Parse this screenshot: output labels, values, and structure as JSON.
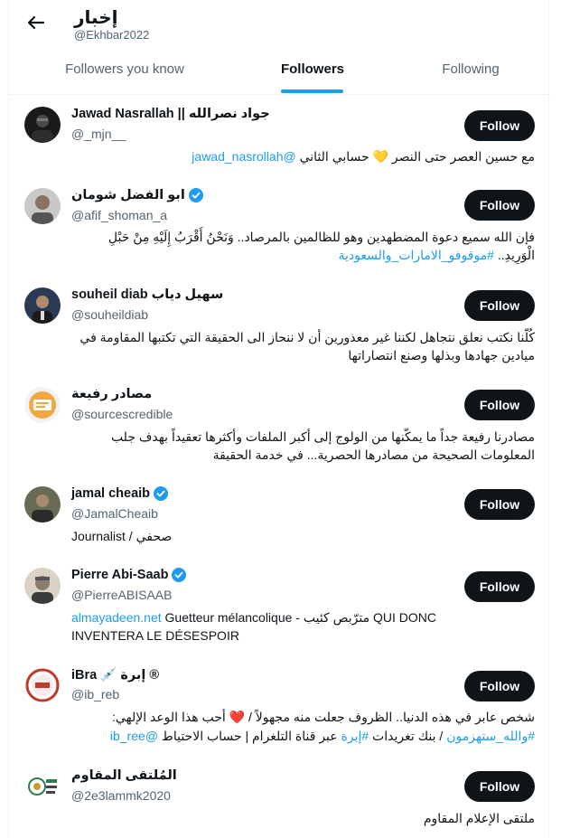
{
  "header": {
    "title": "إخبار",
    "handle": "@Ekhbar2022"
  },
  "tabs": [
    {
      "label": "Followers you know"
    },
    {
      "label": "Followers"
    },
    {
      "label": "Following"
    }
  ],
  "colors": {
    "accent": "#1d9bf0",
    "button_bg": "#0f1419",
    "secondary_text": "#536471",
    "heart": "#e0245e",
    "yellow_heart": "#f5c842"
  },
  "follow_label": "Follow",
  "followers": [
    {
      "name": "Jawad Nasrallah || جواد نصرالله",
      "handle": "@_mjn__",
      "verified": false,
      "bio": {
        "text1": "مع حسين العصر حتى النصر ",
        "emoji": "💛",
        "text2": " حسابي الثاني ",
        "link": "@jawad_nasrollah"
      }
    },
    {
      "name": "ابو الفضل شومان",
      "handle": "@afif_shoman_a",
      "verified": true,
      "bio": {
        "line1": "فإن الله سميع دعوة المضطهدين وهو للظالمين بالمرصاد.. وَنَحْنُ أَقْرَبُ إِلَيْهِ مِنْ حَبْلِ",
        "line2": "الْوَرِيدِ.. ",
        "hashtag": "#موقوفو_الامارات_والسعودية"
      }
    },
    {
      "name": "souheil diab سهيل دياب",
      "handle": "@souheildiab",
      "verified": false,
      "bio": {
        "text": "كُلّنا نكتب نعلق نتجاهل لكننا غير معذورين أن لا ننحاز الى الحقيقة التي تكتبها المقاومة في ميادين جهادها وبذلها وصنع انتصاراتها"
      }
    },
    {
      "name": "مصادر رفيعة",
      "handle": "@sourcescredible",
      "verified": false,
      "bio": {
        "text": "مصادرنا رفيعة جداً ما يمكّنها من الولوج إلى أكبر الملفات وأكثرها تعقيداً بهدف جلب المعلومات الصحيحة من مصادرها الحصرية... في خدمة الحقيقة"
      }
    },
    {
      "name": "jamal cheaib",
      "handle": "@JamalCheaib",
      "verified": true,
      "bio": {
        "text": "Journalist / صحفي"
      }
    },
    {
      "name": "Pierre Abi-Saab",
      "handle": "@PierreABISAAB",
      "verified": true,
      "bio": {
        "link": "almayadeen.net",
        "line1": " Guetteur mélancolique - مترّبص كئيب QUI DONC",
        "line2": "INVENTERA LE DÉSESPOIR"
      }
    },
    {
      "name": "iBra 💉 إبرة ®",
      "handle": "@ib_reb",
      "verified": false,
      "bio": {
        "line1a": "شخص عابر في هذه الدنيا.. الظروف جعلت منه مجهولاً / ",
        "heart": "❤️",
        "line1b": " أحب هذا الوعد الإلهي:",
        "hashtag1": "#والله_ستهزمون",
        "mid1": " / بنك تغريدات ",
        "hashtag2": "#إبرة",
        "mid2": " عبر قناة التلغرام | حساب الاحتياط ",
        "link": "@ib_ree"
      }
    },
    {
      "name": "المُلتقى المقاوم",
      "handle": "@2e3lammk2020",
      "verified": false,
      "bio": {
        "text": "ملتقى الإعلام المقاوم"
      }
    }
  ]
}
